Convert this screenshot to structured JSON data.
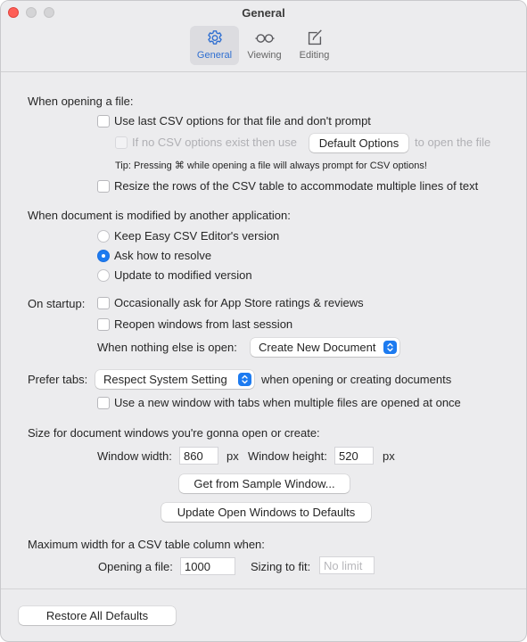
{
  "window": {
    "title": "General"
  },
  "toolbar": {
    "tabs": [
      {
        "label": "General",
        "icon": "gear-icon",
        "active": true
      },
      {
        "label": "Viewing",
        "icon": "glasses-icon",
        "active": false
      },
      {
        "label": "Editing",
        "icon": "edit-icon",
        "active": false
      }
    ]
  },
  "colors": {
    "accent": "#1d7bf0",
    "active_tab_text": "#2f6fd1",
    "close": "#fe5f57"
  },
  "opening": {
    "heading": "When opening a file:",
    "use_last_csv": {
      "label": "Use last CSV options for that file and don't prompt",
      "checked": false
    },
    "if_no_csv": {
      "label_before": "If no CSV options exist then use",
      "button": "Default Options",
      "label_after": "to open the file",
      "checked": false,
      "enabled": false
    },
    "tip": "Tip: Pressing ⌘ while opening a file will always prompt for CSV options!",
    "resize_rows": {
      "label": "Resize the rows of the CSV table to accommodate multiple lines of text",
      "checked": false
    }
  },
  "modified": {
    "heading": "When document is modified by another application:",
    "options": [
      {
        "label": "Keep Easy CSV Editor's version",
        "selected": false
      },
      {
        "label": "Ask how to resolve",
        "selected": true
      },
      {
        "label": "Update to modified version",
        "selected": false
      }
    ]
  },
  "startup": {
    "label": "On startup:",
    "ask_ratings": {
      "label": "Occasionally ask for App Store ratings & reviews",
      "checked": false
    },
    "reopen": {
      "label": "Reopen windows from last session",
      "checked": false
    },
    "nothing_open_label": "When nothing else is open:",
    "nothing_open_value": "Create New Document"
  },
  "tabs_pref": {
    "label": "Prefer tabs:",
    "value": "Respect System Setting",
    "suffix": "when opening or creating documents",
    "new_window": {
      "label": "Use a new window with tabs when multiple files are opened at once",
      "checked": false
    }
  },
  "size": {
    "heading": "Size for document windows you're gonna open or create:",
    "width_label": "Window width:",
    "width_value": "860",
    "height_label": "Window height:",
    "height_value": "520",
    "unit": "px",
    "sample_button": "Get from Sample Window...",
    "update_button": "Update Open Windows to Defaults"
  },
  "maxwidth": {
    "heading": "Maximum width for a CSV table column when:",
    "opening_label": "Opening a file:",
    "opening_value": "1000",
    "fit_label": "Sizing to fit:",
    "fit_placeholder": "No limit"
  },
  "footer": {
    "restore_button": "Restore All Defaults"
  }
}
